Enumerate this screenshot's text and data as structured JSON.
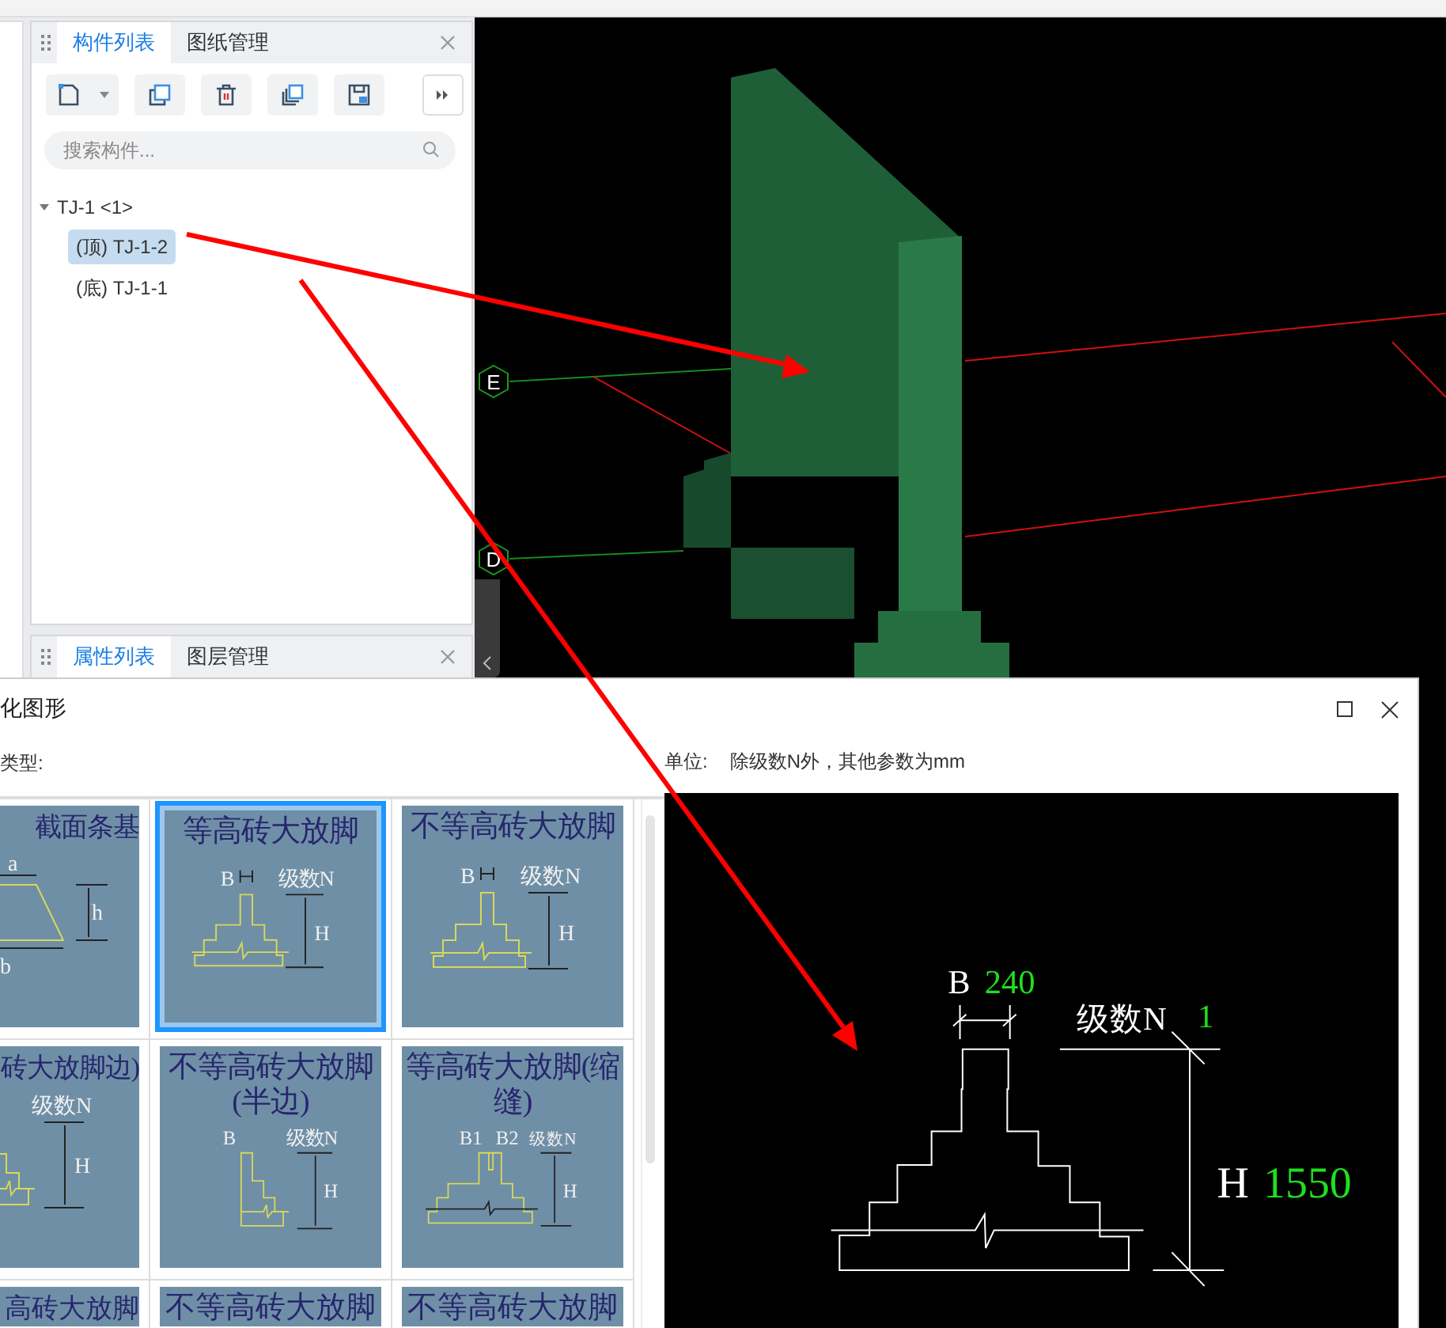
{
  "left_panel": {
    "tabs": [
      {
        "label": "构件列表",
        "selected": true
      },
      {
        "label": "图纸管理",
        "selected": false
      }
    ],
    "search": {
      "placeholder": "搜索构件..."
    },
    "tree": [
      {
        "label": "TJ-1 <1>",
        "expanded": true,
        "selected": false,
        "children": [
          {
            "label": "(顶) TJ-1-2",
            "selected": true
          },
          {
            "label": "(底) TJ-1-1",
            "selected": false
          }
        ]
      }
    ]
  },
  "lower_panel": {
    "tabs": [
      {
        "label": "属性列表",
        "selected": true
      },
      {
        "label": "图层管理",
        "selected": false
      }
    ]
  },
  "viewport": {
    "axes": [
      "E",
      "D"
    ]
  },
  "dialog": {
    "title": "化图形",
    "type_label": "类型:",
    "unit_label": "单位:",
    "unit_text": "除级数N外，其他参数为mm",
    "cards": [
      {
        "title": "截面条基",
        "selected": false,
        "kind": "trapezoid",
        "labels": [
          "a",
          "h",
          "b"
        ]
      },
      {
        "title": "等高砖大放脚",
        "selected": true,
        "kind": "stepped",
        "labels": [
          "B",
          "级数N",
          "H"
        ]
      },
      {
        "title": "不等高砖大放脚",
        "selected": false,
        "kind": "stepped",
        "labels": [
          "B",
          "级数N",
          "H"
        ]
      },
      {
        "title": "砖大放脚边)",
        "selected": false,
        "kind": "half",
        "labels": [
          "级数N",
          "H"
        ]
      },
      {
        "title": "不等高砖大放脚(半边)",
        "selected": false,
        "kind": "half",
        "labels": [
          "B",
          "级数N",
          "H"
        ]
      },
      {
        "title": "等高砖大放脚(缩缝)",
        "selected": false,
        "kind": "joint",
        "labels": [
          "B1",
          "B2",
          "级数N",
          "H"
        ]
      },
      {
        "title": "高砖大放脚",
        "selected": false,
        "kind": "none"
      },
      {
        "title": "不等高砖大放脚",
        "selected": false,
        "kind": "none"
      },
      {
        "title": "不等高砖大放脚",
        "selected": false,
        "kind": "none"
      }
    ],
    "preview": {
      "b_label": "B",
      "b_value": "240",
      "n_label": "级数N",
      "n_value": "1",
      "h_label": "H",
      "h_value": "1550"
    }
  }
}
